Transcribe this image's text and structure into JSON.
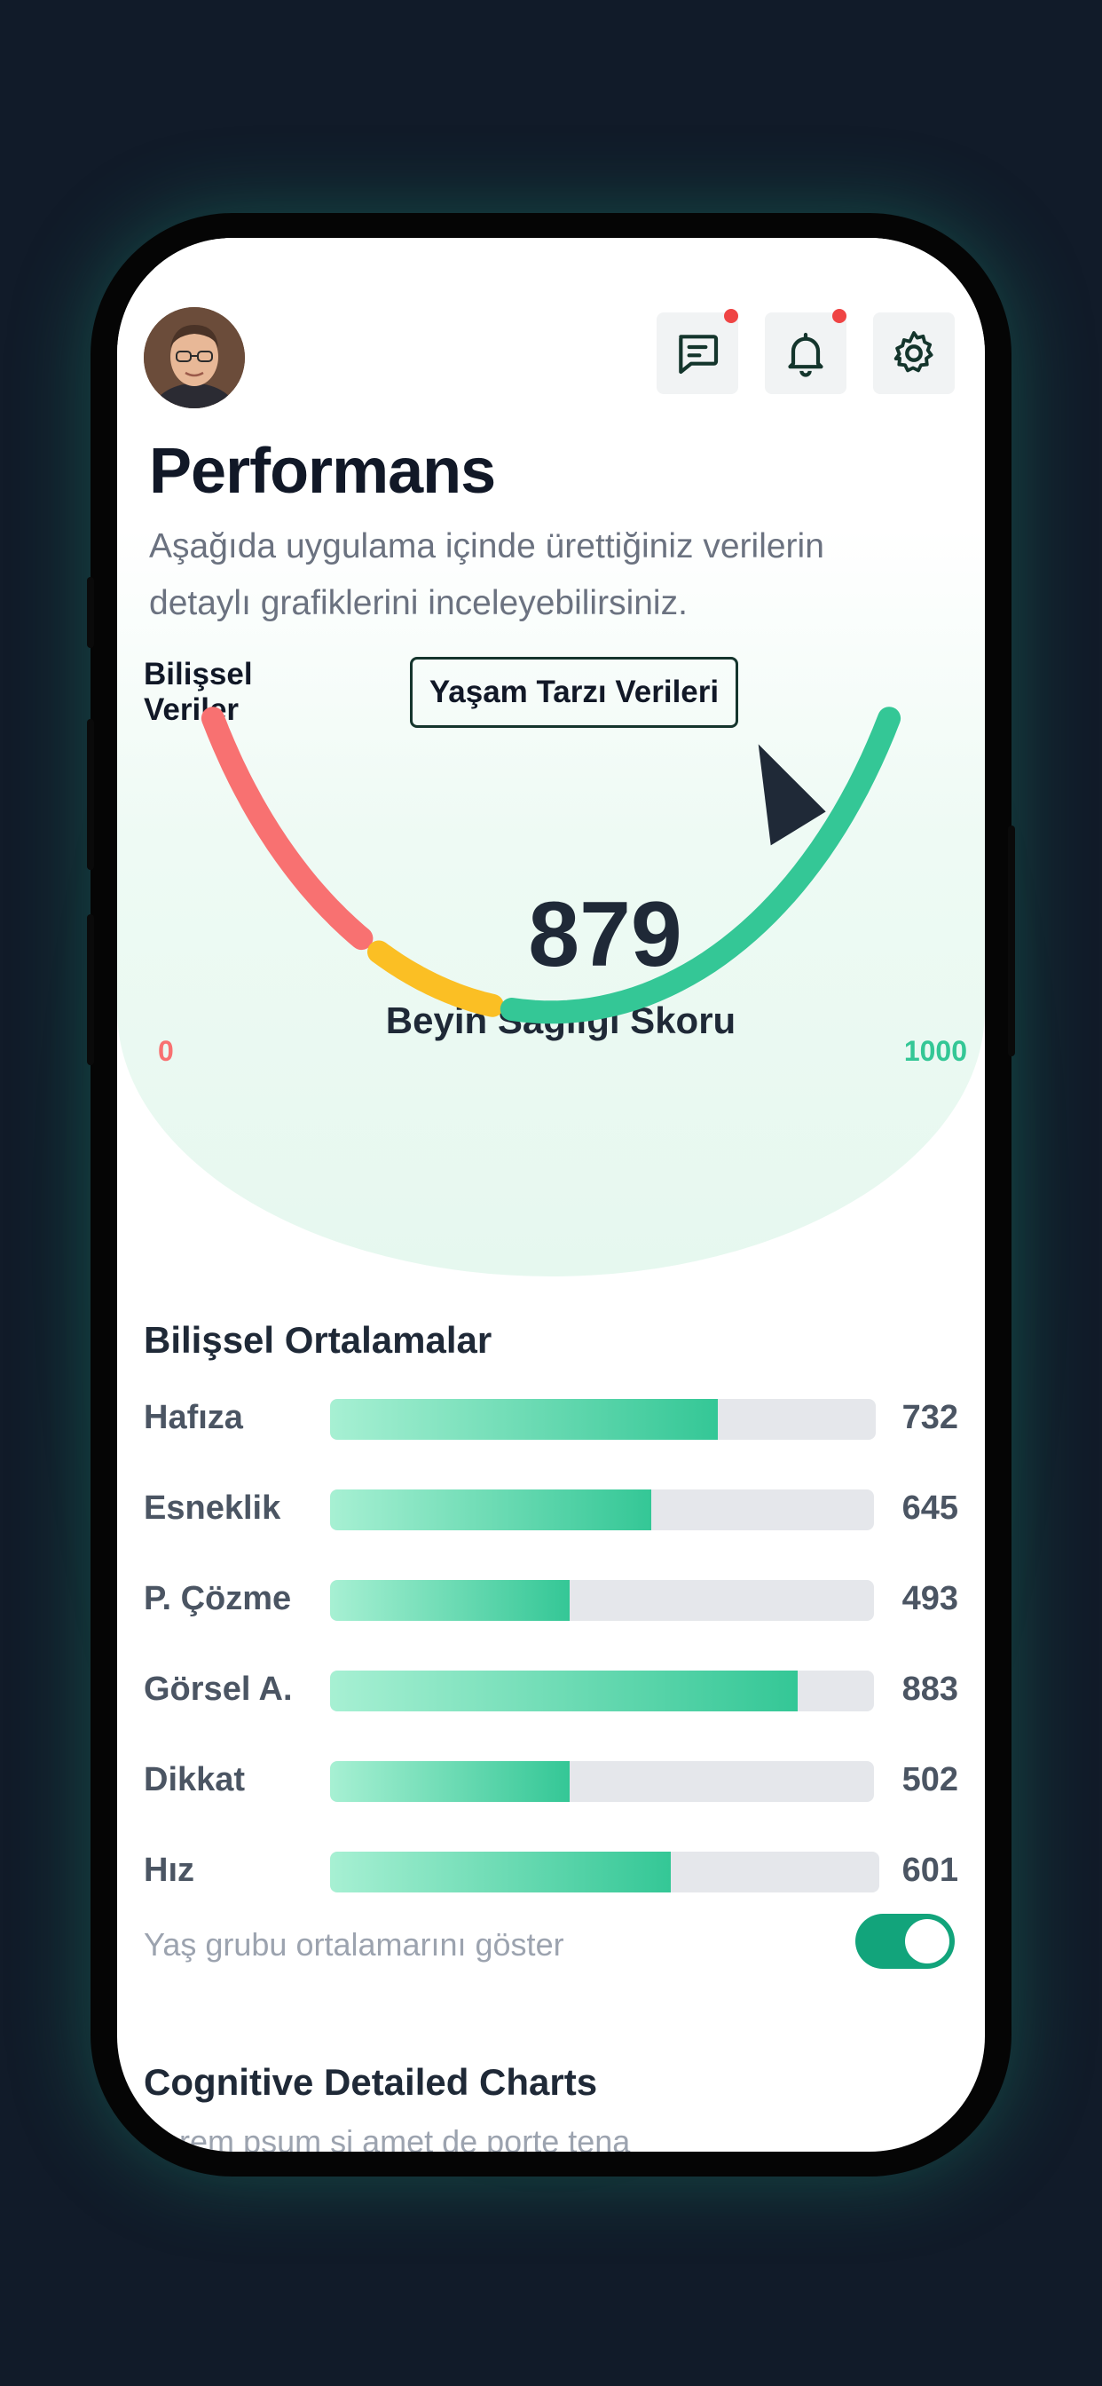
{
  "header": {
    "avatar_alt": "avatar",
    "icons": [
      "chat-icon",
      "bell-icon",
      "gear-icon"
    ]
  },
  "page": {
    "title": "Performans",
    "subtitle": "Aşağıda uygulama içinde ürettiğiniz verilerin detaylı grafiklerini inceleyebilirsiniz."
  },
  "tabs": [
    {
      "label": "Bilişsel Veriler",
      "active": false
    },
    {
      "label": "Yaşam Tarzı Verileri",
      "active": true
    }
  ],
  "gauge": {
    "score": "879",
    "label": "Beyin Sağlığı Skoru",
    "min_label": "0",
    "max_label": "1000",
    "value": 879,
    "max": 1000,
    "segments": [
      {
        "from": 0,
        "to": 0.27,
        "color": "#f87171"
      },
      {
        "from": 0.27,
        "to": 0.44,
        "color": "#fbbf24"
      },
      {
        "from": 0.44,
        "to": 1.0,
        "color": "#34c796"
      }
    ]
  },
  "averages": {
    "title": "Bilişsel Ortalamalar",
    "rows": [
      {
        "label": "Hafıza",
        "value": "732",
        "fill": 0.71
      },
      {
        "label": "Esneklik",
        "value": "645",
        "fill": 0.59
      },
      {
        "label": "P. Çözme",
        "value": "493",
        "fill": 0.44
      },
      {
        "label": "Görsel A.",
        "value": "883",
        "fill": 0.86
      },
      {
        "label": "Dikkat",
        "value": "502",
        "fill": 0.44
      },
      {
        "label": "Hız",
        "value": "601",
        "fill": 0.62
      }
    ],
    "toggle_label": "Yaş grubu ortalamarını göster",
    "toggle_on": true
  },
  "detailed": {
    "title": "Cognitive Detailed Charts",
    "preview": "Lorem psum si amet de porte tena"
  },
  "colors": {
    "accent": "#34c796",
    "toggle": "#12a47b",
    "notification": "#ef4444"
  }
}
